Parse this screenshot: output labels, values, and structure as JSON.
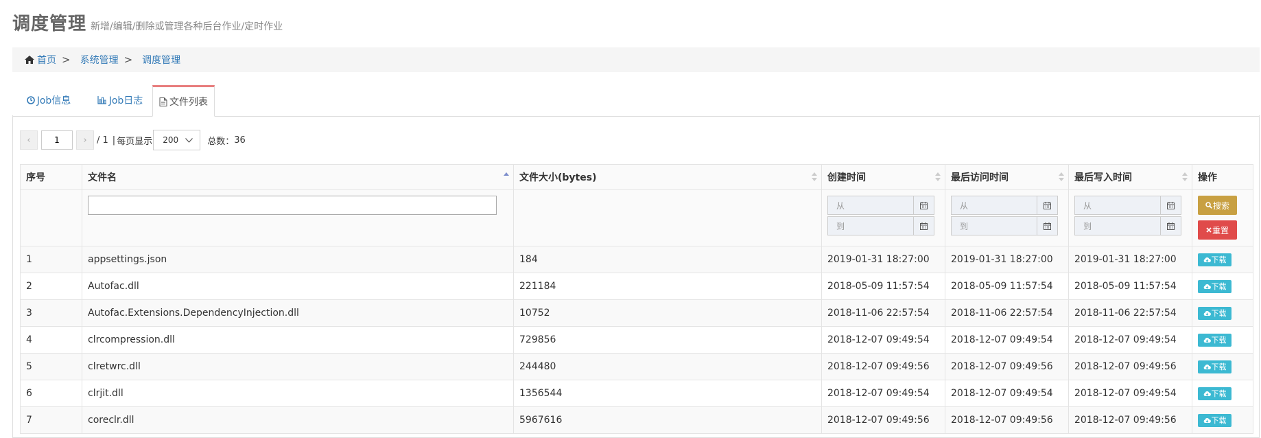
{
  "header": {
    "title": "调度管理",
    "subtitle": "新增/编辑/删除或管理各种后台作业/定时作业"
  },
  "breadcrumb": {
    "items": [
      {
        "label": "首页",
        "icon": "home-icon"
      },
      {
        "label": "系统管理"
      },
      {
        "label": "调度管理"
      }
    ],
    "separator": ">"
  },
  "tabs": [
    {
      "label": "Job信息",
      "icon": "clock-icon",
      "active": false
    },
    {
      "label": "Job日志",
      "icon": "bar-chart-icon",
      "active": false
    },
    {
      "label": "文件列表",
      "icon": "file-icon",
      "active": true
    }
  ],
  "pager": {
    "prev": "‹",
    "next": "›",
    "current_page": "1",
    "total_pages_text": "/ 1",
    "divider": "|",
    "per_page_label": "每页显示",
    "per_page_value": "200",
    "total_label": "总数：",
    "total_count": "36"
  },
  "table": {
    "columns": [
      {
        "label": "序号",
        "sortable": false
      },
      {
        "label": "文件名",
        "sortable": true,
        "sort": "asc"
      },
      {
        "label": "文件大小(bytes)",
        "sortable": true
      },
      {
        "label": "创建时间",
        "sortable": true
      },
      {
        "label": "最后访问时间",
        "sortable": true
      },
      {
        "label": "最后写入时间",
        "sortable": true
      },
      {
        "label": "操作",
        "sortable": false
      }
    ],
    "filters": {
      "from_placeholder": "从",
      "to_placeholder": "到",
      "search_label": "搜索",
      "reset_label": "重置"
    },
    "rows": [
      {
        "no": "1",
        "name": "appsettings.json",
        "size": "184",
        "created": "2019-01-31 18:27:00",
        "accessed": "2019-01-31 18:27:00",
        "written": "2019-01-31 18:27:00",
        "action": "下载"
      },
      {
        "no": "2",
        "name": "Autofac.dll",
        "size": "221184",
        "created": "2018-05-09 11:57:54",
        "accessed": "2018-05-09 11:57:54",
        "written": "2018-05-09 11:57:54",
        "action": "下载"
      },
      {
        "no": "3",
        "name": "Autofac.Extensions.DependencyInjection.dll",
        "size": "10752",
        "created": "2018-11-06 22:57:54",
        "accessed": "2018-11-06 22:57:54",
        "written": "2018-11-06 22:57:54",
        "action": "下载"
      },
      {
        "no": "4",
        "name": "clrcompression.dll",
        "size": "729856",
        "created": "2018-12-07 09:49:54",
        "accessed": "2018-12-07 09:49:54",
        "written": "2018-12-07 09:49:54",
        "action": "下载"
      },
      {
        "no": "5",
        "name": "clretwrc.dll",
        "size": "244480",
        "created": "2018-12-07 09:49:56",
        "accessed": "2018-12-07 09:49:56",
        "written": "2018-12-07 09:49:56",
        "action": "下载"
      },
      {
        "no": "6",
        "name": "clrjit.dll",
        "size": "1356544",
        "created": "2018-12-07 09:49:54",
        "accessed": "2018-12-07 09:49:54",
        "written": "2018-12-07 09:49:54",
        "action": "下载"
      },
      {
        "no": "7",
        "name": "coreclr.dll",
        "size": "5967616",
        "created": "2018-12-07 09:49:56",
        "accessed": "2018-12-07 09:49:56",
        "written": "2018-12-07 09:49:56",
        "action": "下载"
      }
    ]
  },
  "colors": {
    "link": "#337ab7",
    "tab_active_border": "#e77c7c",
    "search_button": "#c8a042",
    "reset_button": "#e04b4a",
    "download_button": "#3cb9d2"
  }
}
